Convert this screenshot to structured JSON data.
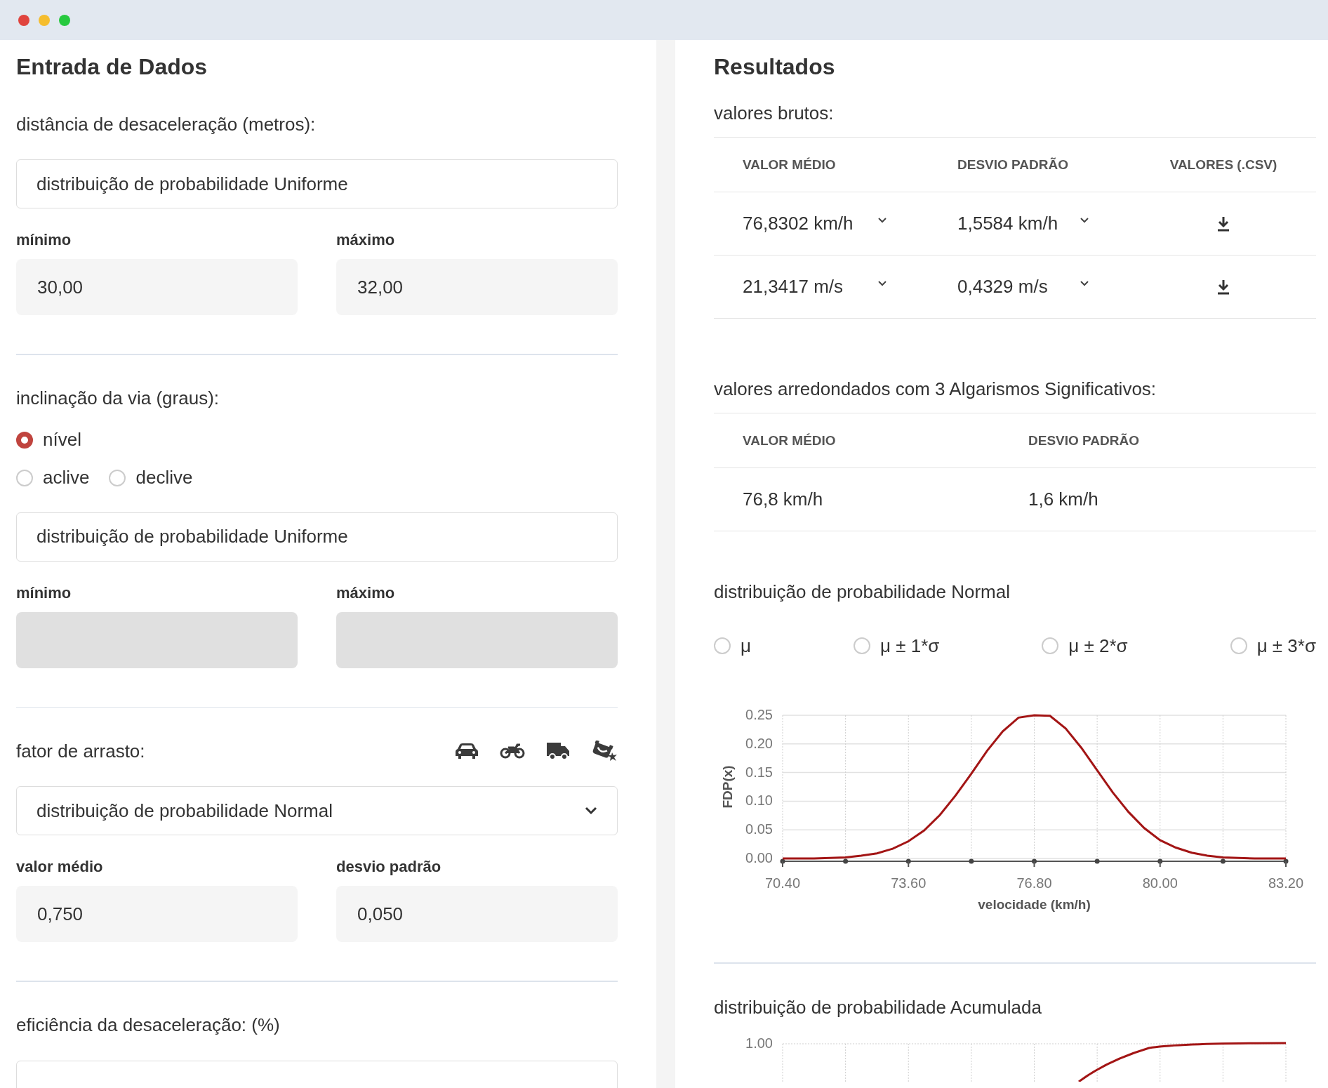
{
  "input_panel": {
    "title": "Entrada de Dados",
    "sections": [
      {
        "label": "distância de desaceleração (metros):",
        "show_vehicles": false,
        "field": {
          "kind": "plain",
          "value": "distribuição de probabilidade Uniforme"
        },
        "params": [
          {
            "label": "mínimo",
            "value": "30,00",
            "disabled": false
          },
          {
            "label": "máximo",
            "value": "32,00",
            "disabled": false
          }
        ]
      },
      {
        "label": "inclinação da via (graus):",
        "show_vehicles": false,
        "options": [
          {
            "label": "nível",
            "selected": true
          },
          {
            "label": "aclive",
            "selected": false
          },
          {
            "label": "declive",
            "selected": false
          }
        ],
        "field": {
          "kind": "plain",
          "value": "distribuição de probabilidade Uniforme"
        },
        "params": [
          {
            "label": "mínimo",
            "disabled": true
          },
          {
            "label": "máximo",
            "disabled": true
          }
        ]
      },
      {
        "label": "fator de arrasto:",
        "show_vehicles": true,
        "field": {
          "kind": "select",
          "value": "distribuição de probabilidade Normal"
        },
        "params": [
          {
            "label": "valor médio",
            "value": "0,750",
            "disabled": false
          },
          {
            "label": "desvio padrão",
            "value": "0,050",
            "disabled": false
          }
        ]
      },
      {
        "label": "eficiência da desaceleração: (%)",
        "show_vehicles": false,
        "field": {
          "kind": "plain"
        }
      }
    ]
  },
  "results_panel": {
    "title": "Resultados",
    "raw": {
      "title": "valores brutos:",
      "columns": [
        "VALOR MÉDIO",
        "DESVIO PADRÃO",
        "VALORES (.CSV)"
      ],
      "rows": [
        {
          "mean": "76,8302 km/h",
          "std": "1,5584 km/h"
        },
        {
          "mean": "21,3417 m/s",
          "std": "0,4329 m/s"
        }
      ]
    },
    "rounded": {
      "title": "valores arredondados com 3 Algarismos Significativos:",
      "columns": [
        "VALOR MÉDIO",
        "DESVIO PADRÃO"
      ],
      "rows": [
        {
          "mean": "76,8 km/h",
          "std": "1,6 km/h"
        }
      ]
    },
    "normal": {
      "title": "distribuição de probabilidade Normal",
      "options": [
        {
          "label": "μ",
          "selected": false
        },
        {
          "label": "μ ± 1*σ",
          "selected": false
        },
        {
          "label": "μ ± 2*σ",
          "selected": false
        },
        {
          "label": "μ ± 3*σ",
          "selected": false
        }
      ],
      "chart_data": {
        "type": "line",
        "grid": true,
        "xlabel": "velocidade (km/h)",
        "ylabel": "FDP(x)",
        "x": [
          70.4,
          70.8,
          71.2,
          71.6,
          72.0,
          72.4,
          72.8,
          73.2,
          73.6,
          74.0,
          74.4,
          74.8,
          75.2,
          75.6,
          76.0,
          76.4,
          76.8,
          77.2,
          77.6,
          78.0,
          78.4,
          78.8,
          79.2,
          79.6,
          80.0,
          80.4,
          80.8,
          81.2,
          81.6,
          82.0,
          82.4,
          82.8,
          83.2
        ],
        "series": [
          {
            "color": "#a31515",
            "values": [
              0.0,
              0.0,
              0.0,
              0.001,
              0.002,
              0.005,
              0.009,
              0.017,
              0.03,
              0.049,
              0.076,
              0.11,
              0.148,
              0.188,
              0.222,
              0.246,
              0.25,
              0.249,
              0.227,
              0.193,
              0.154,
              0.115,
              0.081,
              0.053,
              0.032,
              0.019,
              0.01,
              0.005,
              0.002,
              0.001,
              0.0,
              0.0,
              0.0
            ]
          }
        ],
        "xlim": [
          70.4,
          83.2
        ],
        "ylim": [
          0,
          0.25
        ],
        "xticks": [
          {
            "value": 70.4,
            "label": "70.40"
          },
          {
            "value": 73.6,
            "label": "73.60"
          },
          {
            "value": 76.8,
            "label": "76.80"
          },
          {
            "value": 80.0,
            "label": "80.00"
          },
          {
            "value": 83.2,
            "label": "83.20"
          }
        ],
        "yticks": [
          {
            "value": 0,
            "label": "0.00"
          },
          {
            "value": 0.05,
            "label": "0.05"
          },
          {
            "value": 0.1,
            "label": "0.10"
          },
          {
            "value": 0.15,
            "label": "0.15"
          },
          {
            "value": 0.2,
            "label": "0.20"
          },
          {
            "value": 0.25,
            "label": "0.25"
          }
        ]
      }
    },
    "cumulative": {
      "title": "distribuição de probabilidade Acumulada",
      "tick_label": "1.00"
    }
  }
}
